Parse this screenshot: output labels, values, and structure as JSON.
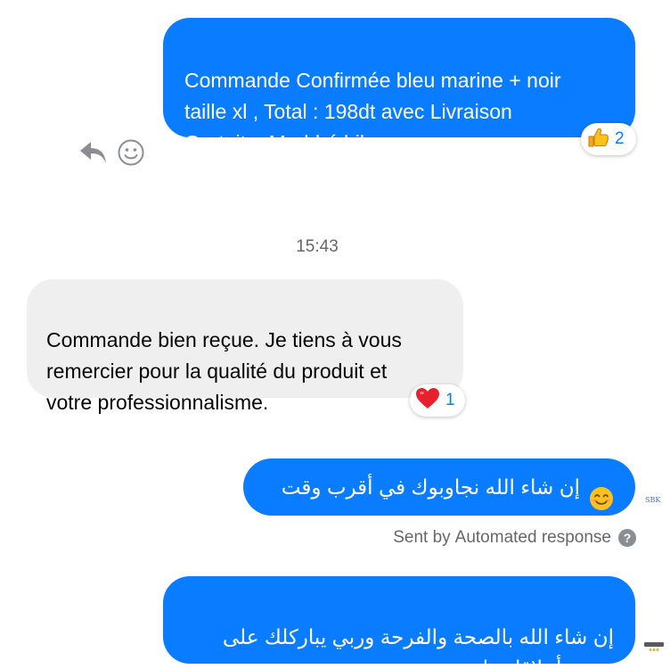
{
  "messages": [
    {
      "id": "msg1",
      "direction": "outgoing",
      "text": "Commande Confirmée bleu marine + noir\ntaille xl , Total : 198dt avec Livraison\nGratuite ,Marhbé bik",
      "reaction": {
        "icon": "thumbs-up-icon",
        "count": "2"
      }
    },
    {
      "id": "msg2",
      "direction": "incoming",
      "text": "Commande bien reçue. Je tiens à vous\nremercier pour la qualité du produit et\nvotre professionnalisme.",
      "reaction": {
        "icon": "heart-icon",
        "count": "1"
      }
    },
    {
      "id": "msg3",
      "direction": "outgoing",
      "text": "إن شاء الله نجاوبوك في أقرب وقت",
      "emoji": "smiling-face-icon"
    },
    {
      "id": "msg4",
      "direction": "outgoing",
      "text": "إن شاء الله بالصحة والفرحة وربي يباركلك على\nحسن  أخلاقك زادة"
    }
  ],
  "timestamp": "15:43",
  "automated": {
    "prefix": "Sent by",
    "link": "Automated response",
    "help_icon": "question-circle-icon"
  },
  "seen_label": "SBK",
  "icons": {
    "reply": "reply-arrow-icon",
    "react": "smiley-icon"
  },
  "colors": {
    "outgoing_bubble": "#0a7cff",
    "incoming_bubble": "#efefef",
    "reaction_count": "#0a7cff",
    "meta_text": "#65676b"
  }
}
